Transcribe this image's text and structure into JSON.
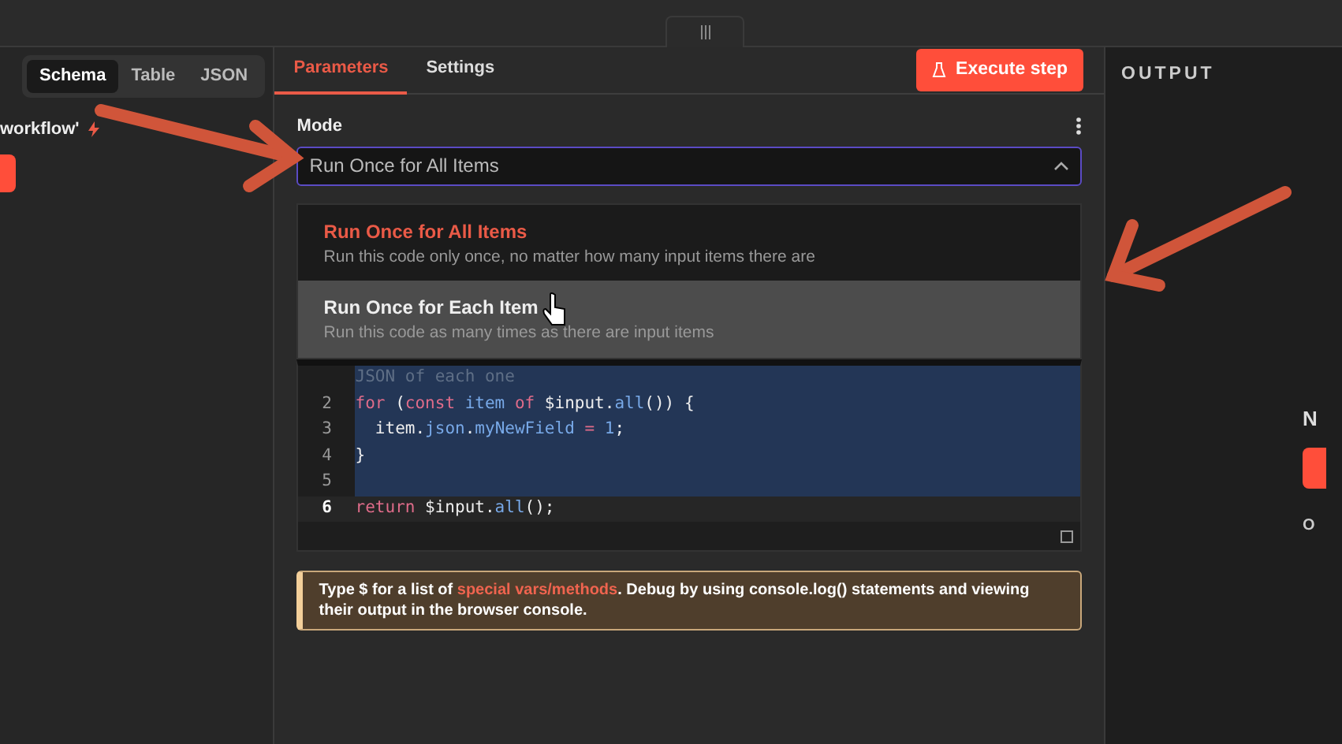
{
  "left_panel": {
    "tabs": [
      {
        "label": "Schema",
        "selected": true
      },
      {
        "label": "Table",
        "selected": false
      },
      {
        "label": "JSON",
        "selected": false
      }
    ],
    "node_title": "workflow'"
  },
  "parameters": {
    "tabs": [
      {
        "label": "Parameters",
        "selected": true
      },
      {
        "label": "Settings",
        "selected": false
      }
    ],
    "execute_button": "Execute step",
    "mode": {
      "label": "Mode",
      "value": "Run Once for All Items",
      "expanded": true,
      "options": [
        {
          "title": "Run Once for All Items",
          "description": "Run this code only once, no matter how many input items there are",
          "selected": true,
          "hovered": false
        },
        {
          "title": "Run Once for Each Item",
          "description": "Run this code as many times as there are input items",
          "selected": false,
          "hovered": true
        }
      ]
    },
    "code": [
      {
        "current": false,
        "selected": true,
        "tokens": [
          {
            "kind": "comment",
            "text": "JSON of each one"
          }
        ]
      },
      {
        "number": "2",
        "current": false,
        "selected": true,
        "tokens": [
          {
            "kind": "keyword",
            "text": "for"
          },
          {
            "kind": "plain",
            "text": " ("
          },
          {
            "kind": "keyword",
            "text": "const "
          },
          {
            "kind": "variable",
            "text": "item "
          },
          {
            "kind": "keyword",
            "text": "of"
          },
          {
            "kind": "plain",
            "text": " $input."
          },
          {
            "kind": "property",
            "text": "all"
          },
          {
            "kind": "plain",
            "text": "()) {"
          }
        ]
      },
      {
        "number": "3",
        "current": false,
        "selected": true,
        "tokens": [
          {
            "kind": "plain",
            "text": "  item."
          },
          {
            "kind": "property",
            "text": "json"
          },
          {
            "kind": "plain",
            "text": "."
          },
          {
            "kind": "property",
            "text": "myNewField "
          },
          {
            "kind": "keyword",
            "text": "= "
          },
          {
            "kind": "property",
            "text": "1"
          },
          {
            "kind": "plain",
            "text": ";"
          }
        ]
      },
      {
        "number": "4",
        "current": false,
        "selected": true,
        "tokens": [
          {
            "kind": "plain",
            "text": "}"
          }
        ]
      },
      {
        "number": "5",
        "current": false,
        "selected": true
      },
      {
        "number": "6",
        "current": true,
        "selected": false,
        "tokens": [
          {
            "kind": "keyword",
            "text": "return"
          },
          {
            "kind": "plain",
            "text": " $input."
          },
          {
            "kind": "property",
            "text": "all"
          },
          {
            "kind": "plain",
            "text": "();"
          }
        ]
      }
    ],
    "hint": "Type $ for a list of **special vars/methods**. Debug by using console.log() statements and viewing their output in the browser console."
  },
  "output_panel": {
    "title": "OUTPUT",
    "heading": "N",
    "note": "O"
  }
}
